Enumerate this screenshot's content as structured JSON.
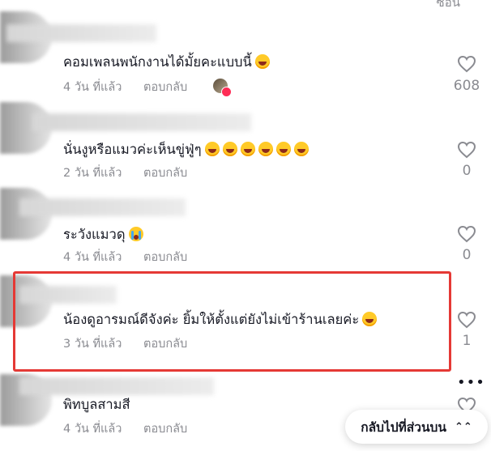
{
  "top_partial_text": "ซ่อน",
  "comments": [
    {
      "text": "คอมเพลนพนักงานได้มั้ยคะแบบนี้",
      "emojis": 1,
      "time": "4 วัน ที่แล้ว",
      "reply": "ตอบกลับ",
      "likes": "608"
    },
    {
      "text": "นั่นงูหรือแมวค่ะเห็นขู่ฟู่ๆ",
      "emojis": 6,
      "time": "2 วัน ที่แล้ว",
      "reply": "ตอบกลับ",
      "likes": "0"
    },
    {
      "text": "ระวังแมวดุ",
      "emojis": 1,
      "time": "4 วัน ที่แล้ว",
      "reply": "ตอบกลับ",
      "likes": "0"
    },
    {
      "text": "น้องดูอารมณ์ดีจังค่ะ ยิ้มให้ตั้งแต่ยังไม่เข้าร้านเลยค่ะ",
      "emojis": 1,
      "time": "3 วัน ที่แล้ว",
      "reply": "ตอบกลับ",
      "likes": "1"
    },
    {
      "text": "พิทบูลสามสี",
      "emojis": 0,
      "time": "4 วัน ที่แล้ว",
      "reply": "ตอบกลับ",
      "likes": ""
    }
  ],
  "back_to_top": "กลับไปที่ส่วนบน",
  "colors": {
    "highlight": "#e53935",
    "muted": "#8a8b91",
    "text": "#161823"
  }
}
